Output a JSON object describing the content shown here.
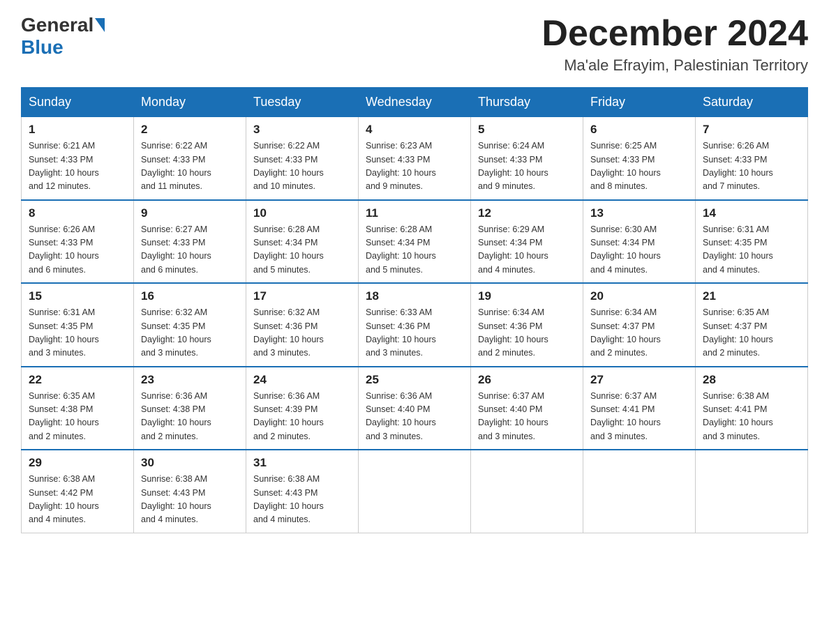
{
  "header": {
    "logo_general": "General",
    "logo_blue": "Blue",
    "month": "December 2024",
    "location": "Ma'ale Efrayim, Palestinian Territory"
  },
  "days_of_week": [
    "Sunday",
    "Monday",
    "Tuesday",
    "Wednesday",
    "Thursday",
    "Friday",
    "Saturday"
  ],
  "weeks": [
    [
      {
        "day": "1",
        "sunrise": "6:21 AM",
        "sunset": "4:33 PM",
        "daylight": "10 hours and 12 minutes."
      },
      {
        "day": "2",
        "sunrise": "6:22 AM",
        "sunset": "4:33 PM",
        "daylight": "10 hours and 11 minutes."
      },
      {
        "day": "3",
        "sunrise": "6:22 AM",
        "sunset": "4:33 PM",
        "daylight": "10 hours and 10 minutes."
      },
      {
        "day": "4",
        "sunrise": "6:23 AM",
        "sunset": "4:33 PM",
        "daylight": "10 hours and 9 minutes."
      },
      {
        "day": "5",
        "sunrise": "6:24 AM",
        "sunset": "4:33 PM",
        "daylight": "10 hours and 9 minutes."
      },
      {
        "day": "6",
        "sunrise": "6:25 AM",
        "sunset": "4:33 PM",
        "daylight": "10 hours and 8 minutes."
      },
      {
        "day": "7",
        "sunrise": "6:26 AM",
        "sunset": "4:33 PM",
        "daylight": "10 hours and 7 minutes."
      }
    ],
    [
      {
        "day": "8",
        "sunrise": "6:26 AM",
        "sunset": "4:33 PM",
        "daylight": "10 hours and 6 minutes."
      },
      {
        "day": "9",
        "sunrise": "6:27 AM",
        "sunset": "4:33 PM",
        "daylight": "10 hours and 6 minutes."
      },
      {
        "day": "10",
        "sunrise": "6:28 AM",
        "sunset": "4:34 PM",
        "daylight": "10 hours and 5 minutes."
      },
      {
        "day": "11",
        "sunrise": "6:28 AM",
        "sunset": "4:34 PM",
        "daylight": "10 hours and 5 minutes."
      },
      {
        "day": "12",
        "sunrise": "6:29 AM",
        "sunset": "4:34 PM",
        "daylight": "10 hours and 4 minutes."
      },
      {
        "day": "13",
        "sunrise": "6:30 AM",
        "sunset": "4:34 PM",
        "daylight": "10 hours and 4 minutes."
      },
      {
        "day": "14",
        "sunrise": "6:31 AM",
        "sunset": "4:35 PM",
        "daylight": "10 hours and 4 minutes."
      }
    ],
    [
      {
        "day": "15",
        "sunrise": "6:31 AM",
        "sunset": "4:35 PM",
        "daylight": "10 hours and 3 minutes."
      },
      {
        "day": "16",
        "sunrise": "6:32 AM",
        "sunset": "4:35 PM",
        "daylight": "10 hours and 3 minutes."
      },
      {
        "day": "17",
        "sunrise": "6:32 AM",
        "sunset": "4:36 PM",
        "daylight": "10 hours and 3 minutes."
      },
      {
        "day": "18",
        "sunrise": "6:33 AM",
        "sunset": "4:36 PM",
        "daylight": "10 hours and 3 minutes."
      },
      {
        "day": "19",
        "sunrise": "6:34 AM",
        "sunset": "4:36 PM",
        "daylight": "10 hours and 2 minutes."
      },
      {
        "day": "20",
        "sunrise": "6:34 AM",
        "sunset": "4:37 PM",
        "daylight": "10 hours and 2 minutes."
      },
      {
        "day": "21",
        "sunrise": "6:35 AM",
        "sunset": "4:37 PM",
        "daylight": "10 hours and 2 minutes."
      }
    ],
    [
      {
        "day": "22",
        "sunrise": "6:35 AM",
        "sunset": "4:38 PM",
        "daylight": "10 hours and 2 minutes."
      },
      {
        "day": "23",
        "sunrise": "6:36 AM",
        "sunset": "4:38 PM",
        "daylight": "10 hours and 2 minutes."
      },
      {
        "day": "24",
        "sunrise": "6:36 AM",
        "sunset": "4:39 PM",
        "daylight": "10 hours and 2 minutes."
      },
      {
        "day": "25",
        "sunrise": "6:36 AM",
        "sunset": "4:40 PM",
        "daylight": "10 hours and 3 minutes."
      },
      {
        "day": "26",
        "sunrise": "6:37 AM",
        "sunset": "4:40 PM",
        "daylight": "10 hours and 3 minutes."
      },
      {
        "day": "27",
        "sunrise": "6:37 AM",
        "sunset": "4:41 PM",
        "daylight": "10 hours and 3 minutes."
      },
      {
        "day": "28",
        "sunrise": "6:38 AM",
        "sunset": "4:41 PM",
        "daylight": "10 hours and 3 minutes."
      }
    ],
    [
      {
        "day": "29",
        "sunrise": "6:38 AM",
        "sunset": "4:42 PM",
        "daylight": "10 hours and 4 minutes."
      },
      {
        "day": "30",
        "sunrise": "6:38 AM",
        "sunset": "4:43 PM",
        "daylight": "10 hours and 4 minutes."
      },
      {
        "day": "31",
        "sunrise": "6:38 AM",
        "sunset": "4:43 PM",
        "daylight": "10 hours and 4 minutes."
      },
      null,
      null,
      null,
      null
    ]
  ],
  "labels": {
    "sunrise_prefix": "Sunrise: ",
    "sunset_prefix": "Sunset: ",
    "daylight_prefix": "Daylight: "
  }
}
